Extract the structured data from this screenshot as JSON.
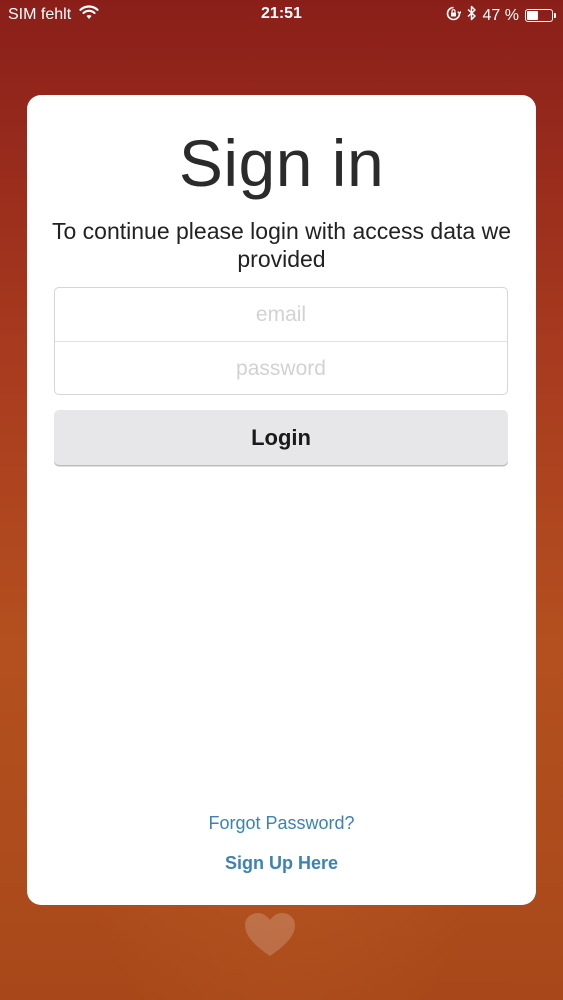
{
  "status_bar": {
    "carrier": "SIM fehlt",
    "time": "21:51",
    "battery_percent_text": "47 %",
    "battery_level": 0.47,
    "icons": [
      "wifi-icon",
      "orientation-lock-icon",
      "bluetooth-icon",
      "battery-icon"
    ]
  },
  "login": {
    "title": "Sign in",
    "subtitle": "To continue please login with access data we provided",
    "email_placeholder": "email",
    "password_placeholder": "password",
    "login_button": "Login",
    "forgot_password": "Forgot Password?",
    "sign_up": "Sign Up Here"
  },
  "colors": {
    "background_top": "#8a1f1a",
    "background_bottom": "#b4501f",
    "link": "#3b82b5",
    "button_bg": "#e7e7ea"
  }
}
